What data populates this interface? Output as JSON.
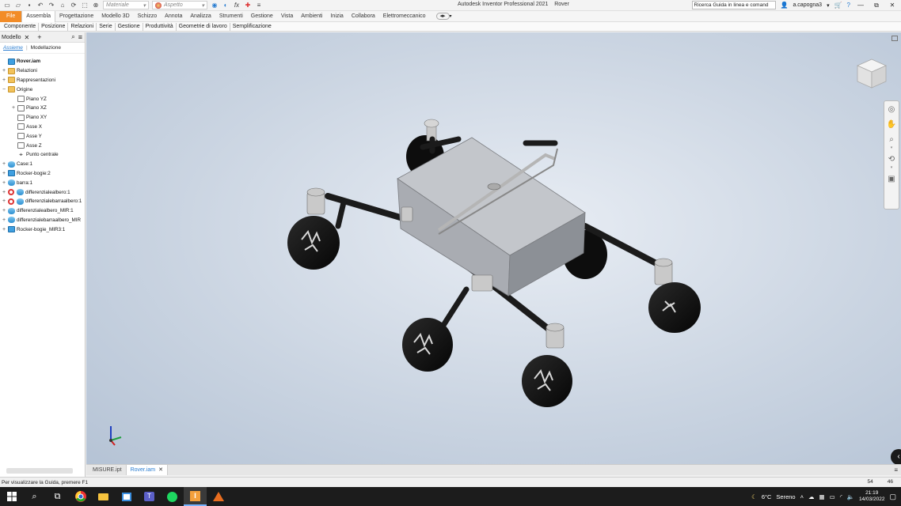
{
  "app": {
    "title": "Autodesk Inventor Professional 2021",
    "document": "Rover",
    "search_placeholder": "Ricerca Guida in linea e comand",
    "user": "a.capogna3"
  },
  "quick_access": {
    "material_combo": "Materiale",
    "appearance_combo": "Aspetto"
  },
  "ribbon": {
    "tabs": [
      "File",
      "Assembla",
      "Progettazione",
      "Modello 3D",
      "Schizzo",
      "Annota",
      "Analizza",
      "Strumenti",
      "Gestione",
      "Vista",
      "Ambienti",
      "Inizia",
      "Collabora",
      "Elettromeccanico"
    ],
    "active_tab": "Assembla",
    "panels": [
      "Componente",
      "Posizione",
      "Relazioni",
      "Serie",
      "Gestione",
      "Produttività",
      "Geometrie di lavoro",
      "Semplificazione"
    ]
  },
  "browser": {
    "title": "Modello",
    "tabs": [
      "Assieme",
      "Modellazione"
    ],
    "active_tab": "Assieme",
    "tree": [
      {
        "label": "Rover.iam",
        "icon": "asm",
        "level": 0,
        "exp": "",
        "root": true
      },
      {
        "label": "Relazioni",
        "icon": "folder",
        "level": 0,
        "exp": "+"
      },
      {
        "label": "Rappresentazioni",
        "icon": "folder",
        "level": 0,
        "exp": "+"
      },
      {
        "label": "Origine",
        "icon": "folder",
        "level": 0,
        "exp": "−"
      },
      {
        "label": "Piano YZ",
        "icon": "plane",
        "level": 1,
        "exp": ""
      },
      {
        "label": "Piano XZ",
        "icon": "plane",
        "level": 1,
        "exp": "+"
      },
      {
        "label": "Piano XY",
        "icon": "plane",
        "level": 1,
        "exp": ""
      },
      {
        "label": "Asse X",
        "icon": "axis",
        "level": 1,
        "exp": ""
      },
      {
        "label": "Asse Y",
        "icon": "axis",
        "level": 1,
        "exp": ""
      },
      {
        "label": "Asse Z",
        "icon": "axis",
        "level": 1,
        "exp": ""
      },
      {
        "label": "Punto centrale",
        "icon": "point",
        "level": 1,
        "exp": ""
      },
      {
        "label": "Case:1",
        "icon": "part",
        "level": 0,
        "exp": "+"
      },
      {
        "label": "Rocker-bogie:2",
        "icon": "asm",
        "level": 0,
        "exp": "+"
      },
      {
        "label": "barra:1",
        "icon": "part",
        "level": 0,
        "exp": "+"
      },
      {
        "label": "differenzialealbero:1",
        "icon": "redpart",
        "level": 0,
        "exp": "+"
      },
      {
        "label": "differenzialebarraalbero:1",
        "icon": "redpart",
        "level": 0,
        "exp": "+"
      },
      {
        "label": "differenzialealbero_MIR:1",
        "icon": "part",
        "level": 0,
        "exp": "+"
      },
      {
        "label": "differenzialebarraalbero_MIR",
        "icon": "part",
        "level": 0,
        "exp": "+"
      },
      {
        "label": "Rocker-bogie_MIR3:1",
        "icon": "asm",
        "level": 0,
        "exp": "+"
      }
    ]
  },
  "document_tabs": [
    {
      "label": "MISURE.ipt",
      "active": false
    },
    {
      "label": "Rover.iam",
      "active": true
    }
  ],
  "status": {
    "message": "Per visualizzare la Guida, premere F1",
    "count_a": "54",
    "count_b": "46"
  },
  "taskbar": {
    "weather_temp": "6°C",
    "weather_text": "Sereno",
    "time": "21:19",
    "date": "14/03/2022"
  },
  "colors": {
    "accent": "#f28c28",
    "link": "#2a7dd1"
  }
}
